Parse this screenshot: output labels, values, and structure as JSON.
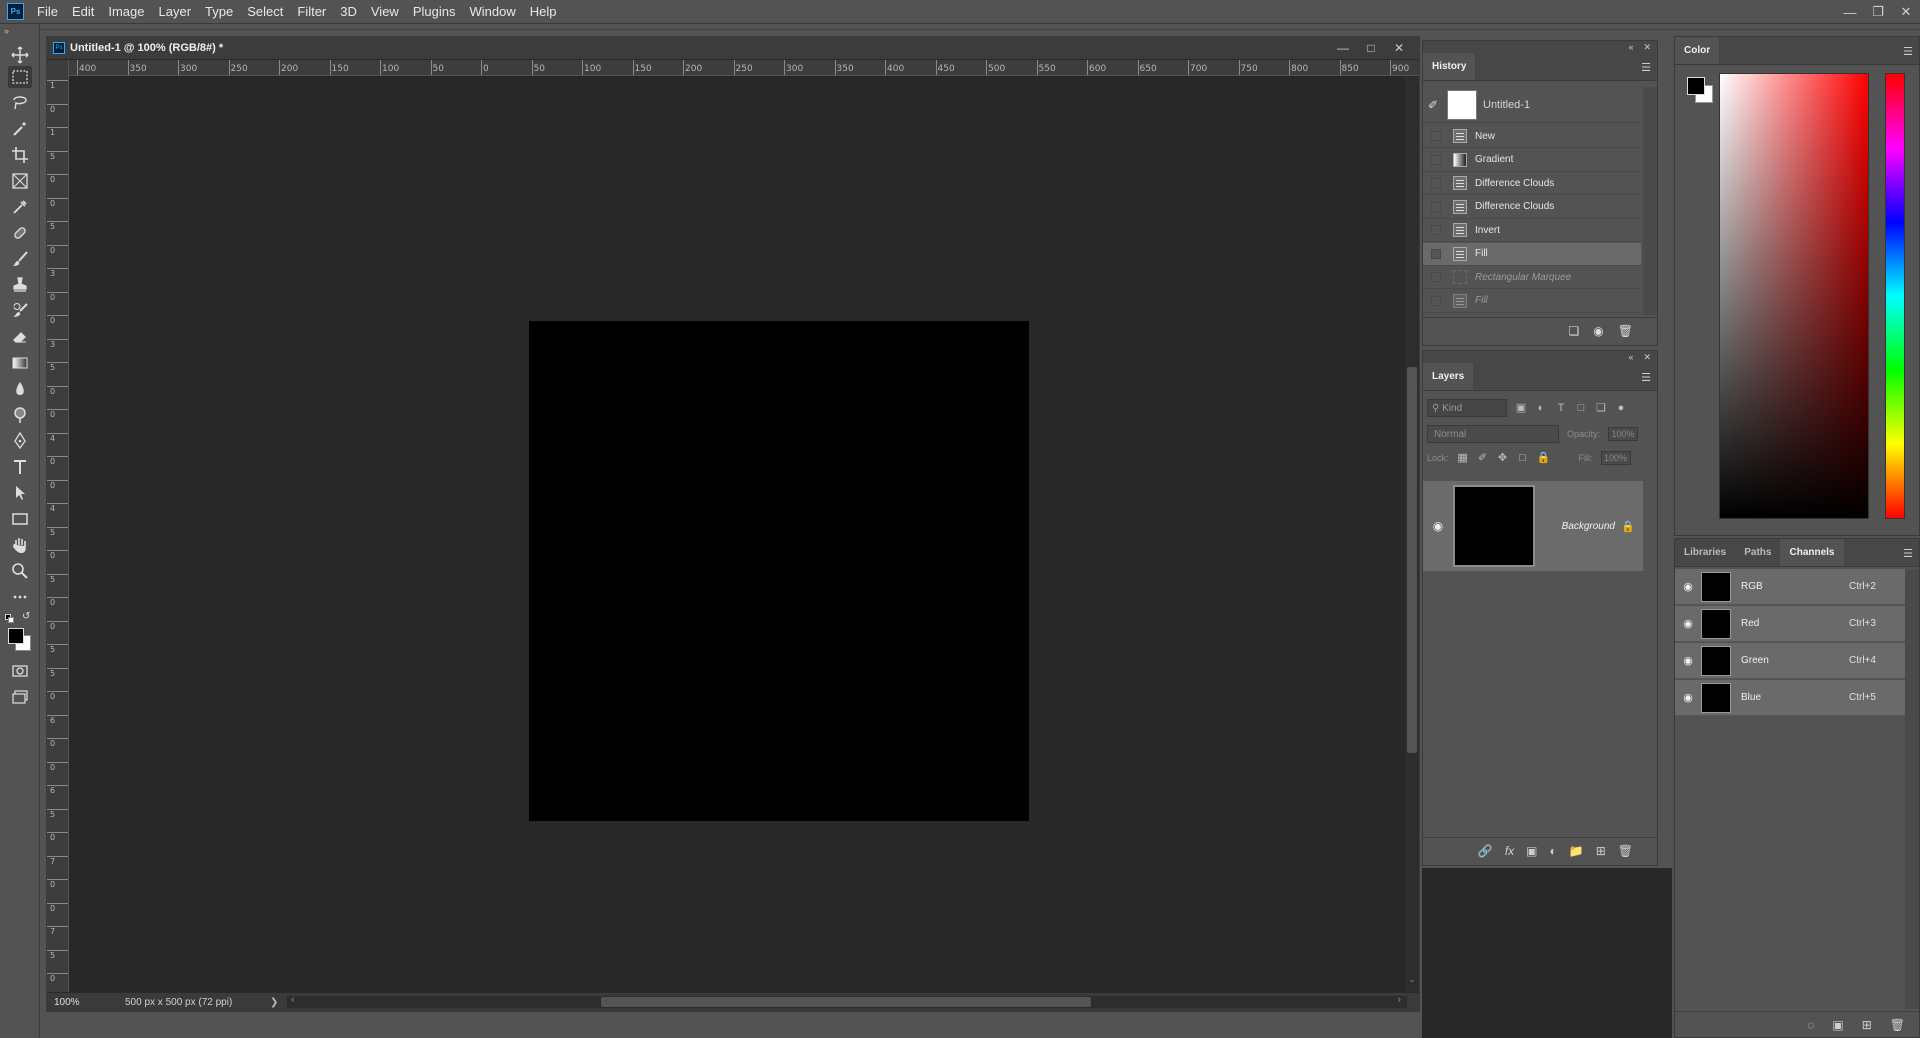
{
  "app": {
    "logo": "Ps"
  },
  "menu": [
    "File",
    "Edit",
    "Image",
    "Layer",
    "Type",
    "Select",
    "Filter",
    "3D",
    "View",
    "Plugins",
    "Window",
    "Help"
  ],
  "window_controls": [
    "minimize",
    "restore",
    "close"
  ],
  "toolbar": {
    "tools": [
      "move-tool",
      "rectangular-marquee-tool",
      "lasso-tool",
      "magic-wand-tool",
      "crop-tool",
      "frame-tool",
      "eyedropper-tool",
      "healing-brush-tool",
      "brush-tool",
      "clone-stamp-tool",
      "history-brush-tool",
      "eraser-tool",
      "gradient-tool",
      "blur-tool",
      "dodge-tool",
      "pen-tool",
      "type-tool",
      "path-selection-tool",
      "rectangle-tool",
      "hand-tool",
      "zoom-tool",
      "more-tools",
      "swap-colors",
      "quick-mask",
      "screen-mode"
    ],
    "active": "rectangular-marquee-tool"
  },
  "document": {
    "title": "Untitled-1 @ 100% (RGB/8#) *",
    "zoom": "100%",
    "info": "500 px x 500 px (72 ppi)",
    "ruler_h": [
      "400",
      "350",
      "300",
      "250",
      "200",
      "150",
      "100",
      "50",
      "0",
      "50",
      "100",
      "150",
      "200",
      "250",
      "300",
      "350",
      "400",
      "450",
      "500",
      "550",
      "600",
      "650",
      "700",
      "750",
      "800",
      "850",
      "900"
    ],
    "ruler_v": [
      "1",
      "0",
      "1",
      "5",
      "0",
      "0",
      "5",
      "0",
      "3",
      "0",
      "0",
      "3",
      "5",
      "0",
      "0",
      "4",
      "0",
      "0",
      "4",
      "5",
      "0",
      "5",
      "0",
      "0",
      "5",
      "5",
      "0",
      "6",
      "0",
      "0",
      "6",
      "5",
      "0",
      "7",
      "0",
      "0",
      "7",
      "5",
      "0"
    ],
    "canvas_color": "#000000"
  },
  "history": {
    "tab": "History",
    "snapshot": "Untitled-1",
    "items": [
      {
        "label": "New",
        "icon": "doc",
        "state": "normal"
      },
      {
        "label": "Gradient",
        "icon": "gradient",
        "state": "normal"
      },
      {
        "label": "Difference Clouds",
        "icon": "doc",
        "state": "normal"
      },
      {
        "label": "Difference Clouds",
        "icon": "doc",
        "state": "normal"
      },
      {
        "label": "Invert",
        "icon": "doc",
        "state": "normal"
      },
      {
        "label": "Fill",
        "icon": "doc",
        "state": "selected"
      },
      {
        "label": "Rectangular Marquee",
        "icon": "marquee",
        "state": "undone"
      },
      {
        "label": "Fill",
        "icon": "doc",
        "state": "undone"
      }
    ]
  },
  "layers": {
    "tab": "Layers",
    "filter_placeholder": "Kind",
    "blend_mode": "Normal",
    "opacity_label": "Opacity:",
    "opacity_value": "100%",
    "lock_label": "Lock:",
    "fill_label": "Fill:",
    "fill_value": "100%",
    "items": [
      {
        "name": "Background",
        "locked": true,
        "visible": true
      }
    ]
  },
  "color": {
    "tab": "Color",
    "foreground": "#000000",
    "background": "#ffffff"
  },
  "channels": {
    "tabs": [
      "Libraries",
      "Paths",
      "Channels"
    ],
    "active_tab": "Channels",
    "items": [
      {
        "name": "RGB",
        "shortcut": "Ctrl+2"
      },
      {
        "name": "Red",
        "shortcut": "Ctrl+3"
      },
      {
        "name": "Green",
        "shortcut": "Ctrl+4"
      },
      {
        "name": "Blue",
        "shortcut": "Ctrl+5"
      }
    ]
  }
}
